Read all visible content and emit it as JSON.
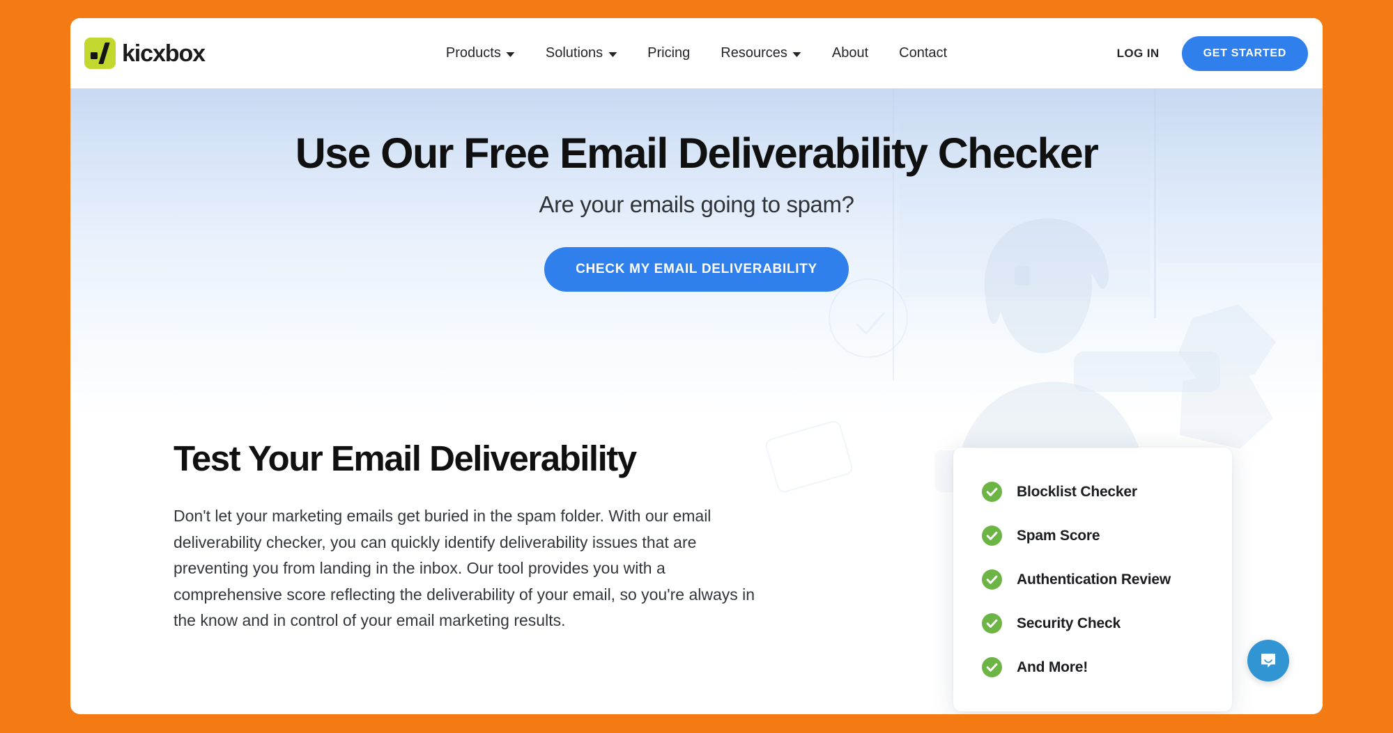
{
  "theme": {
    "page_background": "#F47B14",
    "accent_blue": "#2F80ED",
    "logo_green": "#C3D82E",
    "check_green": "#6CB544",
    "chat_blue": "#3195D4",
    "hero_gradient_top": "#C7D9F2",
    "hero_gradient_bottom": "#FFFFFF"
  },
  "navbar": {
    "brand_name": "kicxbox",
    "logo_icon": "kickbox-slash-logo-icon",
    "menu": [
      {
        "label": "Products",
        "has_dropdown": true
      },
      {
        "label": "Solutions",
        "has_dropdown": true
      },
      {
        "label": "Pricing",
        "has_dropdown": false
      },
      {
        "label": "Resources",
        "has_dropdown": true
      },
      {
        "label": "About",
        "has_dropdown": false
      },
      {
        "label": "Contact",
        "has_dropdown": false
      }
    ],
    "login_label": "LOG IN",
    "get_started_label": "GET STARTED"
  },
  "hero": {
    "title": "Use Our Free Email Deliverability Checker",
    "subtitle": "Are your emails going to spam?",
    "cta_label": "CHECK MY EMAIL DELIVERABILITY"
  },
  "main": {
    "title": "Test Your Email Deliverability",
    "body": "Don't let your marketing emails get buried in the spam folder. With our email deliverability checker, you can quickly identify deliverability issues that are preventing you from landing in the inbox. Our tool provides you with a comprehensive score reflecting the deliverability of your email, so you're always in the know and in control of your email marketing results."
  },
  "feature_card": {
    "items": [
      {
        "label": "Blocklist Checker",
        "icon": "check-circle-icon"
      },
      {
        "label": "Spam Score",
        "icon": "check-circle-icon"
      },
      {
        "label": "Authentication Review",
        "icon": "check-circle-icon"
      },
      {
        "label": "Security Check",
        "icon": "check-circle-icon"
      },
      {
        "label": "And More!",
        "icon": "check-circle-icon"
      }
    ]
  },
  "chat_widget": {
    "icon": "chat-bubble-smile-icon"
  }
}
